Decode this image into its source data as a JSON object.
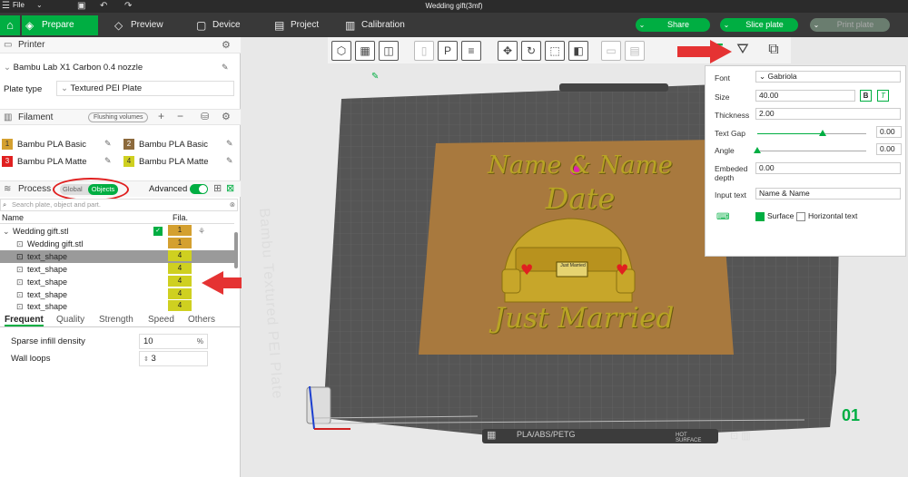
{
  "window": {
    "title": "Wedding gift(3mf)",
    "menu": "File"
  },
  "tabs": [
    {
      "label": "Prepare"
    },
    {
      "label": "Preview"
    },
    {
      "label": "Device"
    },
    {
      "label": "Project"
    },
    {
      "label": "Calibration"
    }
  ],
  "actions": {
    "share": "Share",
    "slice": "Slice plate",
    "print": "Print plate"
  },
  "printer": {
    "section": "Printer",
    "name": "Bambu Lab X1 Carbon 0.4 nozzle",
    "plate_label": "Plate type",
    "plate_value": "Textured PEI Plate"
  },
  "filament": {
    "section": "Filament",
    "flushing": "Flushing volumes",
    "items": [
      {
        "num": "1",
        "name": "Bambu PLA Basic",
        "color": "#d4a030"
      },
      {
        "num": "2",
        "name": "Bambu PLA Basic",
        "color": "#8c6a3c"
      },
      {
        "num": "3",
        "name": "Bambu PLA Matte",
        "color": "#e02020"
      },
      {
        "num": "4",
        "name": "Bambu PLA Matte",
        "color": "#cfd020"
      }
    ]
  },
  "process": {
    "section": "Process",
    "global": "Global",
    "objects": "Objects",
    "advanced": "Advanced",
    "search_placeholder": "Search plate, object and part."
  },
  "objects": {
    "col_name": "Name",
    "col_fila": "Fila.",
    "rows": [
      {
        "name": "Wedding gift.stl",
        "fila": "1"
      },
      {
        "name": "Wedding gift.stl",
        "fila": "1"
      },
      {
        "name": "text_shape",
        "fila": "4"
      },
      {
        "name": "text_shape",
        "fila": "4"
      },
      {
        "name": "text_shape",
        "fila": "4"
      },
      {
        "name": "text_shape",
        "fila": "4"
      },
      {
        "name": "text_shape",
        "fila": "4"
      }
    ]
  },
  "settings_tabs": [
    {
      "label": "Frequent"
    },
    {
      "label": "Quality"
    },
    {
      "label": "Strength"
    },
    {
      "label": "Speed"
    },
    {
      "label": "Others"
    }
  ],
  "settings": {
    "infill_label": "Sparse infill density",
    "infill_value": "10",
    "infill_unit": "%",
    "walls_label": "Wall loops",
    "walls_value": "3"
  },
  "text_panel": {
    "font_label": "Font",
    "font_value": "Gabriola",
    "size_label": "Size",
    "size_value": "40.00",
    "bold": "B",
    "italic": "T",
    "thickness_label": "Thickness",
    "thickness_value": "2.00",
    "gap_label": "Text Gap",
    "gap_value": "0.00",
    "gap_level": 0.6,
    "angle_label": "Angle",
    "angle_value": "0.00",
    "angle_level": 0.0,
    "embed_label": "Embeded depth",
    "embed_value": "0.00",
    "input_label": "Input text",
    "input_value": "Name & Name",
    "surface": "Surface",
    "horizontal": "Horizontal text"
  },
  "plate": {
    "side_label": "Bambu Textured PEI Plate",
    "number": "01",
    "bottom_label": "PLA/ABS/PETG",
    "hot_label": "HOT SURFACE"
  },
  "model": {
    "line1": "Name & Name",
    "line2": "Date",
    "line3": "Just Married",
    "plate_text": "Just Married"
  },
  "colors": {
    "accent": "#00ae42",
    "annotation": "#e53333"
  }
}
